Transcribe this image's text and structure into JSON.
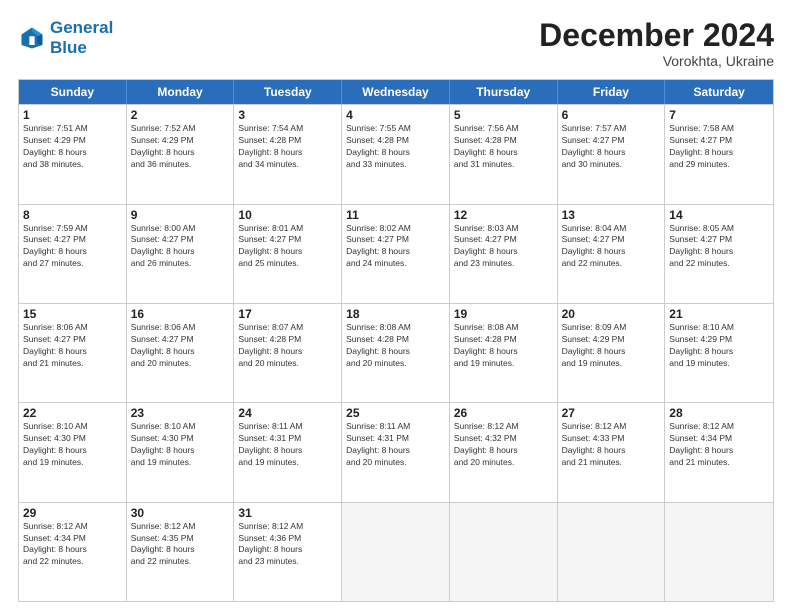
{
  "header": {
    "logo_line1": "General",
    "logo_line2": "Blue",
    "month": "December 2024",
    "location": "Vorokhta, Ukraine"
  },
  "weekdays": [
    "Sunday",
    "Monday",
    "Tuesday",
    "Wednesday",
    "Thursday",
    "Friday",
    "Saturday"
  ],
  "weeks": [
    [
      {
        "day": "1",
        "info": "Sunrise: 7:51 AM\nSunset: 4:29 PM\nDaylight: 8 hours\nand 38 minutes."
      },
      {
        "day": "2",
        "info": "Sunrise: 7:52 AM\nSunset: 4:29 PM\nDaylight: 8 hours\nand 36 minutes."
      },
      {
        "day": "3",
        "info": "Sunrise: 7:54 AM\nSunset: 4:28 PM\nDaylight: 8 hours\nand 34 minutes."
      },
      {
        "day": "4",
        "info": "Sunrise: 7:55 AM\nSunset: 4:28 PM\nDaylight: 8 hours\nand 33 minutes."
      },
      {
        "day": "5",
        "info": "Sunrise: 7:56 AM\nSunset: 4:28 PM\nDaylight: 8 hours\nand 31 minutes."
      },
      {
        "day": "6",
        "info": "Sunrise: 7:57 AM\nSunset: 4:27 PM\nDaylight: 8 hours\nand 30 minutes."
      },
      {
        "day": "7",
        "info": "Sunrise: 7:58 AM\nSunset: 4:27 PM\nDaylight: 8 hours\nand 29 minutes."
      }
    ],
    [
      {
        "day": "8",
        "info": "Sunrise: 7:59 AM\nSunset: 4:27 PM\nDaylight: 8 hours\nand 27 minutes."
      },
      {
        "day": "9",
        "info": "Sunrise: 8:00 AM\nSunset: 4:27 PM\nDaylight: 8 hours\nand 26 minutes."
      },
      {
        "day": "10",
        "info": "Sunrise: 8:01 AM\nSunset: 4:27 PM\nDaylight: 8 hours\nand 25 minutes."
      },
      {
        "day": "11",
        "info": "Sunrise: 8:02 AM\nSunset: 4:27 PM\nDaylight: 8 hours\nand 24 minutes."
      },
      {
        "day": "12",
        "info": "Sunrise: 8:03 AM\nSunset: 4:27 PM\nDaylight: 8 hours\nand 23 minutes."
      },
      {
        "day": "13",
        "info": "Sunrise: 8:04 AM\nSunset: 4:27 PM\nDaylight: 8 hours\nand 22 minutes."
      },
      {
        "day": "14",
        "info": "Sunrise: 8:05 AM\nSunset: 4:27 PM\nDaylight: 8 hours\nand 22 minutes."
      }
    ],
    [
      {
        "day": "15",
        "info": "Sunrise: 8:06 AM\nSunset: 4:27 PM\nDaylight: 8 hours\nand 21 minutes."
      },
      {
        "day": "16",
        "info": "Sunrise: 8:06 AM\nSunset: 4:27 PM\nDaylight: 8 hours\nand 20 minutes."
      },
      {
        "day": "17",
        "info": "Sunrise: 8:07 AM\nSunset: 4:28 PM\nDaylight: 8 hours\nand 20 minutes."
      },
      {
        "day": "18",
        "info": "Sunrise: 8:08 AM\nSunset: 4:28 PM\nDaylight: 8 hours\nand 20 minutes."
      },
      {
        "day": "19",
        "info": "Sunrise: 8:08 AM\nSunset: 4:28 PM\nDaylight: 8 hours\nand 19 minutes."
      },
      {
        "day": "20",
        "info": "Sunrise: 8:09 AM\nSunset: 4:29 PM\nDaylight: 8 hours\nand 19 minutes."
      },
      {
        "day": "21",
        "info": "Sunrise: 8:10 AM\nSunset: 4:29 PM\nDaylight: 8 hours\nand 19 minutes."
      }
    ],
    [
      {
        "day": "22",
        "info": "Sunrise: 8:10 AM\nSunset: 4:30 PM\nDaylight: 8 hours\nand 19 minutes."
      },
      {
        "day": "23",
        "info": "Sunrise: 8:10 AM\nSunset: 4:30 PM\nDaylight: 8 hours\nand 19 minutes."
      },
      {
        "day": "24",
        "info": "Sunrise: 8:11 AM\nSunset: 4:31 PM\nDaylight: 8 hours\nand 19 minutes."
      },
      {
        "day": "25",
        "info": "Sunrise: 8:11 AM\nSunset: 4:31 PM\nDaylight: 8 hours\nand 20 minutes."
      },
      {
        "day": "26",
        "info": "Sunrise: 8:12 AM\nSunset: 4:32 PM\nDaylight: 8 hours\nand 20 minutes."
      },
      {
        "day": "27",
        "info": "Sunrise: 8:12 AM\nSunset: 4:33 PM\nDaylight: 8 hours\nand 21 minutes."
      },
      {
        "day": "28",
        "info": "Sunrise: 8:12 AM\nSunset: 4:34 PM\nDaylight: 8 hours\nand 21 minutes."
      }
    ],
    [
      {
        "day": "29",
        "info": "Sunrise: 8:12 AM\nSunset: 4:34 PM\nDaylight: 8 hours\nand 22 minutes."
      },
      {
        "day": "30",
        "info": "Sunrise: 8:12 AM\nSunset: 4:35 PM\nDaylight: 8 hours\nand 22 minutes."
      },
      {
        "day": "31",
        "info": "Sunrise: 8:12 AM\nSunset: 4:36 PM\nDaylight: 8 hours\nand 23 minutes."
      },
      {
        "day": "",
        "info": ""
      },
      {
        "day": "",
        "info": ""
      },
      {
        "day": "",
        "info": ""
      },
      {
        "day": "",
        "info": ""
      }
    ]
  ]
}
